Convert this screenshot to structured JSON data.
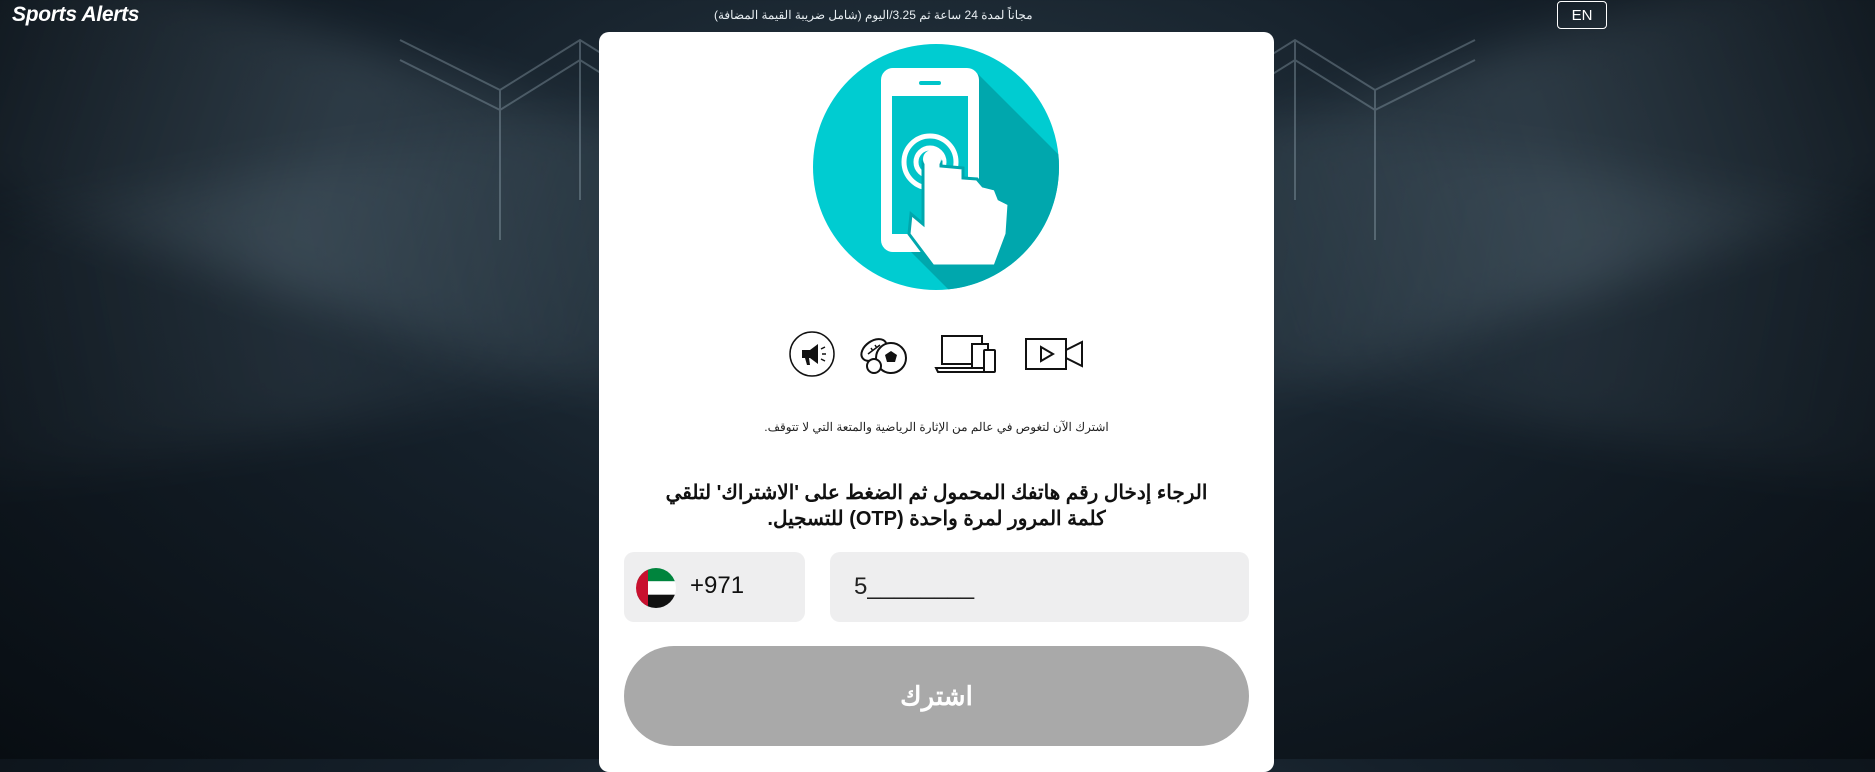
{
  "header": {
    "logo": "Sports Alerts",
    "price_text": "مجاناً لمدة 24 ساعة ثم 3.25/اليوم (شامل ضريبة القيمة المضافة)",
    "language_button": "EN"
  },
  "card": {
    "hero_icon": "phone-tap-icon",
    "features": [
      "megaphone-icon",
      "sports-balls-icon",
      "devices-icon",
      "video-icon"
    ],
    "tagline": "اشترك الآن لتغوص في عالم من الإثارة الرياضية والمتعة التي لا تتوقف.",
    "instruction": "الرجاء إدخال رقم هاتفك المحمول ثم الضغط على 'الاشتراك' لتلقي كلمة المرور لمرة واحدة (OTP) للتسجيل.",
    "country": {
      "flag": "uae-flag-icon",
      "code": "+971"
    },
    "phone_input": {
      "value": "5________"
    },
    "subscribe_button": "اشترك"
  },
  "colors": {
    "hero_teal": "#00ccd1",
    "button_gray": "#a9a9a9",
    "input_bg": "#eeeeef"
  }
}
